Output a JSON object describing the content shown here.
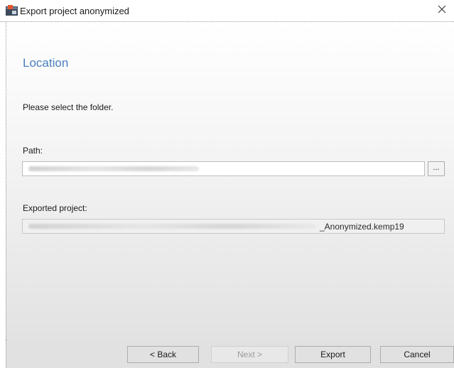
{
  "window": {
    "title": "Export project anonymized"
  },
  "content": {
    "heading": "Location",
    "description": "Please select the folder.",
    "path_label": "Path:",
    "browse_label": "...",
    "exported_label": "Exported project:",
    "exported_suffix": "_Anonymized.kemp19"
  },
  "footer": {
    "back_label": "< Back",
    "next_label": "Next >",
    "export_label": "Export",
    "cancel_label": "Cancel"
  },
  "colors": {
    "heading": "#4a7fc1",
    "footer_bg": "#e1e1e1"
  }
}
